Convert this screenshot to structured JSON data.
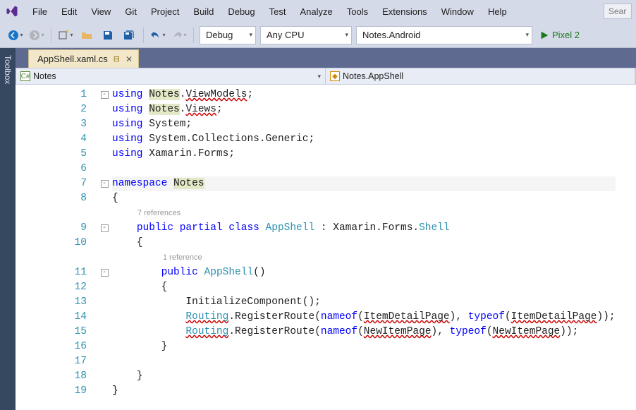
{
  "menubar": {
    "items": [
      "File",
      "Edit",
      "View",
      "Git",
      "Project",
      "Build",
      "Debug",
      "Test",
      "Analyze",
      "Tools",
      "Extensions",
      "Window",
      "Help"
    ],
    "search_placeholder": "Sear"
  },
  "toolbar": {
    "configuration": "Debug",
    "platform": "Any CPU",
    "startup_project": "Notes.Android",
    "run_target": "Pixel 2 "
  },
  "sidestrip": {
    "label": "Toolbox"
  },
  "tab": {
    "title": "AppShell.xaml.cs",
    "pinned": true
  },
  "navbar": {
    "left": "Notes",
    "right": "Notes.AppShell"
  },
  "code": {
    "lines": [
      {
        "n": 1,
        "fold": "-",
        "tokens": [
          {
            "t": "using ",
            "c": "kw"
          },
          {
            "t": "Notes",
            "c": "hl"
          },
          {
            "t": "."
          },
          {
            "t": "ViewModels",
            "c": "err"
          },
          {
            "t": ";"
          }
        ]
      },
      {
        "n": 2,
        "tokens": [
          {
            "t": "using ",
            "c": "kw"
          },
          {
            "t": "Notes",
            "c": "hl"
          },
          {
            "t": "."
          },
          {
            "t": "Views",
            "c": "err"
          },
          {
            "t": ";"
          }
        ]
      },
      {
        "n": 3,
        "tokens": [
          {
            "t": "using ",
            "c": "kw"
          },
          {
            "t": "System;"
          }
        ]
      },
      {
        "n": 4,
        "tokens": [
          {
            "t": "using ",
            "c": "kw"
          },
          {
            "t": "System.Collections.Generic;"
          }
        ]
      },
      {
        "n": 5,
        "tokens": [
          {
            "t": "using ",
            "c": "kw"
          },
          {
            "t": "Xamarin.Forms;"
          }
        ]
      },
      {
        "n": 6,
        "tokens": []
      },
      {
        "n": 7,
        "fold": "-",
        "cur": true,
        "tokens": [
          {
            "t": "namespace ",
            "c": "kw"
          },
          {
            "t": "Notes",
            "c": "hl"
          }
        ]
      },
      {
        "n": 8,
        "tokens": [
          {
            "t": "{"
          }
        ]
      },
      {
        "codelens": "7 references"
      },
      {
        "n": 9,
        "fold": "-",
        "tokens": [
          {
            "t": "    "
          },
          {
            "t": "public partial class ",
            "c": "kw"
          },
          {
            "t": "AppShell",
            "c": "typ"
          },
          {
            "t": " : Xamarin.Forms."
          },
          {
            "t": "Shell",
            "c": "typ"
          }
        ]
      },
      {
        "n": 10,
        "tokens": [
          {
            "t": "    {"
          }
        ]
      },
      {
        "codelens": "1 reference"
      },
      {
        "n": 11,
        "fold": "-",
        "tokens": [
          {
            "t": "        "
          },
          {
            "t": "public ",
            "c": "kw"
          },
          {
            "t": "AppShell",
            "c": "typ"
          },
          {
            "t": "()"
          }
        ]
      },
      {
        "n": 12,
        "tokens": [
          {
            "t": "        {"
          }
        ]
      },
      {
        "n": 13,
        "tokens": [
          {
            "t": "            InitializeComponent();"
          }
        ]
      },
      {
        "n": 14,
        "tokens": [
          {
            "t": "            "
          },
          {
            "t": "Routing",
            "c": "typ err"
          },
          {
            "t": ".RegisterRoute("
          },
          {
            "t": "nameof",
            "c": "kw"
          },
          {
            "t": "("
          },
          {
            "t": "ItemDetailPage",
            "c": "err"
          },
          {
            "t": "), "
          },
          {
            "t": "typeof",
            "c": "kw"
          },
          {
            "t": "("
          },
          {
            "t": "ItemDetailPage",
            "c": "err"
          },
          {
            "t": "));"
          }
        ]
      },
      {
        "n": 15,
        "tokens": [
          {
            "t": "            "
          },
          {
            "t": "Routing",
            "c": "typ err"
          },
          {
            "t": ".RegisterRoute("
          },
          {
            "t": "nameof",
            "c": "kw"
          },
          {
            "t": "("
          },
          {
            "t": "NewItemPage",
            "c": "err"
          },
          {
            "t": "), "
          },
          {
            "t": "typeof",
            "c": "kw"
          },
          {
            "t": "("
          },
          {
            "t": "NewItemPage",
            "c": "err"
          },
          {
            "t": "));"
          }
        ]
      },
      {
        "n": 16,
        "tokens": [
          {
            "t": "        }"
          }
        ]
      },
      {
        "n": 17,
        "tokens": []
      },
      {
        "n": 18,
        "tokens": [
          {
            "t": "    }"
          }
        ]
      },
      {
        "n": 19,
        "tokens": [
          {
            "t": "}"
          }
        ]
      }
    ]
  }
}
